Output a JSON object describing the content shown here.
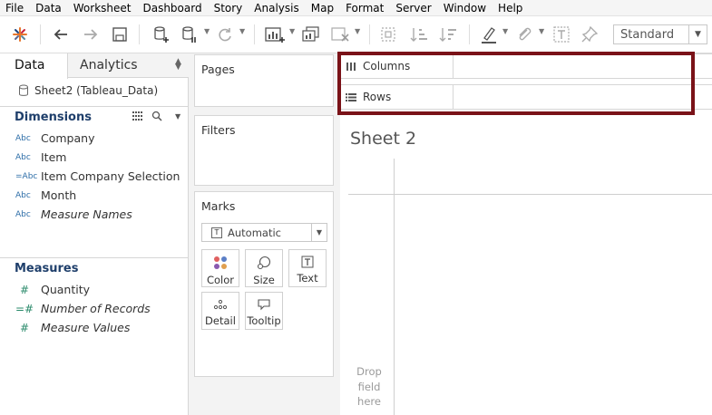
{
  "menu": [
    "File",
    "Data",
    "Worksheet",
    "Dashboard",
    "Story",
    "Analysis",
    "Map",
    "Format",
    "Server",
    "Window",
    "Help"
  ],
  "toolbar": {
    "icons": [
      "tableau-logo-icon",
      "undo-icon",
      "redo-icon",
      "save-icon",
      "new-datasource-icon",
      "pause-updates-icon",
      "refresh-icon",
      "new-worksheet-icon",
      "duplicate-icon",
      "clear-sheet-icon",
      "group-icon",
      "sort-ascending-icon",
      "sort-descending-icon",
      "highlight-icon",
      "attach-icon",
      "label-icon",
      "pin-icon"
    ],
    "fit_value": "Standard"
  },
  "datapane": {
    "tab_data": "Data",
    "tab_analytics": "Analytics",
    "datasource": "Sheet2 (Tableau_Data)",
    "dimensions_title": "Dimensions",
    "measures_title": "Measures",
    "dimensions": [
      {
        "type": "Abc",
        "name": "Company",
        "italic": false
      },
      {
        "type": "Abc",
        "name": "Item",
        "italic": false
      },
      {
        "type": "=Abc",
        "name": "Item Company Selection",
        "italic": false
      },
      {
        "type": "Abc",
        "name": "Month",
        "italic": false
      },
      {
        "type": "Abc",
        "name": "Measure Names",
        "italic": true
      }
    ],
    "measures": [
      {
        "type": "#",
        "name": "Quantity",
        "italic": false
      },
      {
        "type": "=#",
        "name": "Number of Records",
        "italic": true
      },
      {
        "type": "#",
        "name": "Measure Values",
        "italic": true
      }
    ]
  },
  "cards": {
    "pages": "Pages",
    "filters": "Filters",
    "marks": "Marks",
    "mark_type": "Automatic",
    "mark_type_icon": "T",
    "buttons": [
      "Color",
      "Size",
      "Text",
      "Detail",
      "Tooltip"
    ]
  },
  "shelves": {
    "columns": "Columns",
    "rows": "Rows"
  },
  "highlight_color": "#7a1218",
  "sheet": {
    "title": "Sheet 2",
    "drop_field": [
      "Drop",
      "field",
      "here"
    ]
  }
}
